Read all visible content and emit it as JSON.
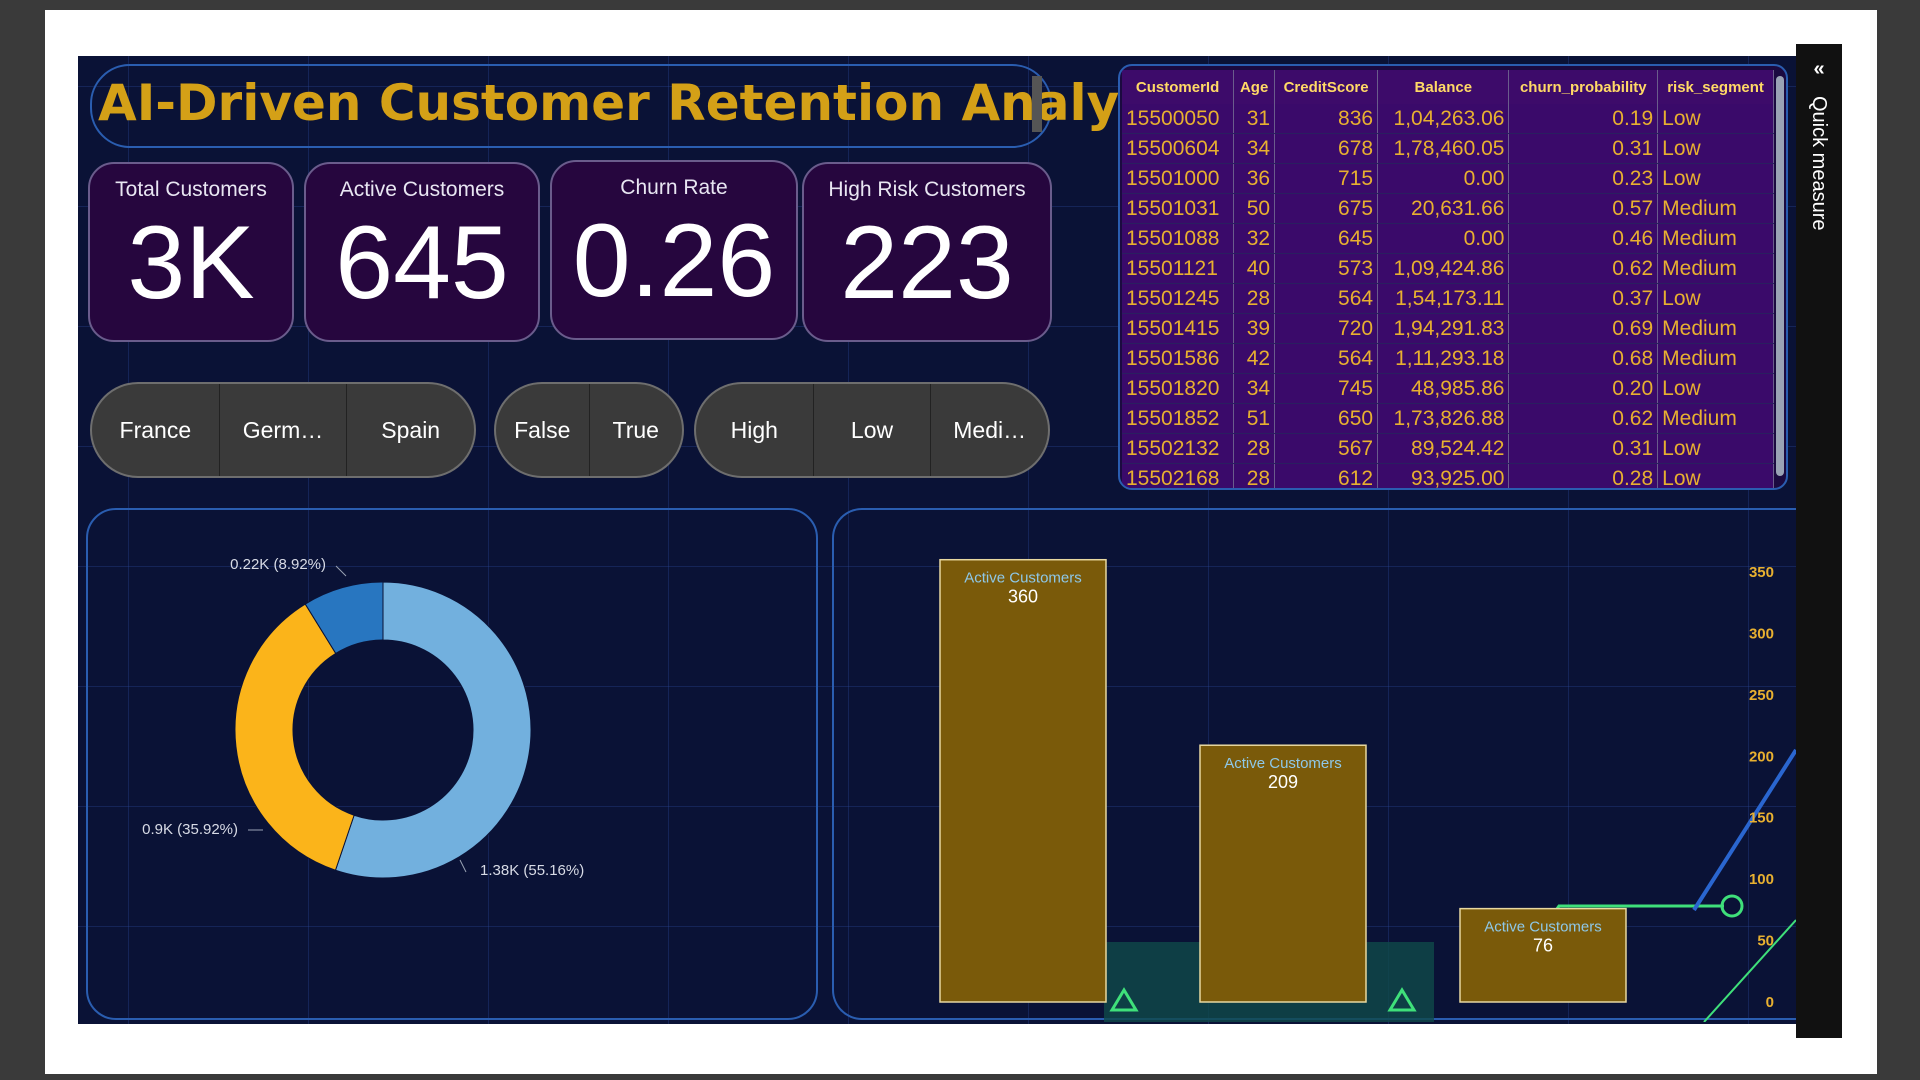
{
  "title": "AI-Driven Customer Retention Analysis",
  "kpis": [
    {
      "label": "Total Customers",
      "value": "3K"
    },
    {
      "label": "Active Customers",
      "value": "645"
    },
    {
      "label": "Churn Rate",
      "value": "0.26"
    },
    {
      "label": "High Risk Customers",
      "value": "223"
    }
  ],
  "slicers": {
    "geography": [
      "France",
      "Germ…",
      "Spain"
    ],
    "active": [
      "False",
      "True"
    ],
    "risk": [
      "High",
      "Low",
      "Medi…"
    ]
  },
  "table": {
    "columns": [
      "CustomerId",
      "Age",
      "CreditScore",
      "Balance",
      "churn_probability",
      "risk_segment"
    ],
    "rows": [
      [
        "15500050",
        "31",
        "836",
        "1,04,263.06",
        "0.19",
        "Low"
      ],
      [
        "15500604",
        "34",
        "678",
        "1,78,460.05",
        "0.31",
        "Low"
      ],
      [
        "15501000",
        "36",
        "715",
        "0.00",
        "0.23",
        "Low"
      ],
      [
        "15501031",
        "50",
        "675",
        "20,631.66",
        "0.57",
        "Medium"
      ],
      [
        "15501088",
        "32",
        "645",
        "0.00",
        "0.46",
        "Medium"
      ],
      [
        "15501121",
        "40",
        "573",
        "1,09,424.86",
        "0.62",
        "Medium"
      ],
      [
        "15501245",
        "28",
        "564",
        "1,54,173.11",
        "0.37",
        "Low"
      ],
      [
        "15501415",
        "39",
        "720",
        "1,94,291.83",
        "0.69",
        "Medium"
      ],
      [
        "15501586",
        "42",
        "564",
        "1,11,293.18",
        "0.68",
        "Medium"
      ],
      [
        "15501820",
        "34",
        "745",
        "48,985.86",
        "0.20",
        "Low"
      ],
      [
        "15501852",
        "51",
        "650",
        "1,73,826.88",
        "0.62",
        "Medium"
      ],
      [
        "15502132",
        "28",
        "567",
        "89,524.42",
        "0.31",
        "Low"
      ],
      [
        "15502168",
        "28",
        "612",
        "93,925.00",
        "0.28",
        "Low"
      ]
    ]
  },
  "quick_measure": "Quick measure",
  "colors": {
    "background": "#0a1236",
    "title": "#d4a017",
    "kpi_bg": "#26063e",
    "table_cell": "#e8b030",
    "donut": [
      "#72b0de",
      "#fbb41a",
      "#2876c0"
    ],
    "bar": "#7a5a0a"
  },
  "chart_data": [
    {
      "type": "pie",
      "slices": [
        {
          "value": 1.38,
          "label": "1.38K (55.16%)",
          "percent": 55.16
        },
        {
          "value": 0.9,
          "label": "0.9K (35.92%)",
          "percent": 35.92
        },
        {
          "value": 0.22,
          "label": "0.22K (8.92%)",
          "percent": 8.92
        }
      ]
    },
    {
      "type": "bar",
      "categories": [
        "",
        "",
        ""
      ],
      "series": [
        {
          "name": "Active Customers",
          "values": [
            360,
            209,
            76
          ]
        }
      ],
      "ylim": [
        0,
        350
      ],
      "yticks": [
        0,
        50,
        100,
        150,
        200,
        250,
        300,
        350
      ]
    }
  ]
}
